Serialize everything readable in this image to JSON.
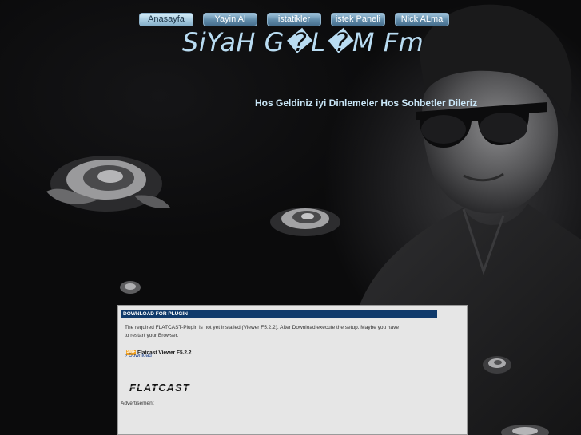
{
  "nav": {
    "items": [
      {
        "label": "Anasayfa",
        "active": true
      },
      {
        "label": "Yayin Al",
        "active": false
      },
      {
        "label": "istatikler",
        "active": false
      },
      {
        "label": "istek Paneli",
        "active": false
      },
      {
        "label": "Nick ALma",
        "active": false
      }
    ]
  },
  "site": {
    "title": "SiYaH G�L�M Fm",
    "welcome": "Hos Geldiniz iyi Dinlemeler Hos Sohbetler Dileriz"
  },
  "plugin_panel": {
    "header": "DOWNLOAD FOR PLUGIN",
    "message": "The required FLATCAST-Plugin is not yet installed (Viewer F5.2.2). After Download execute the setup. Maybe you have to restart your Browser.",
    "badge": "SWF",
    "plugin_name": "Flatcast Viewer F5.2.2",
    "download_chevron": "›",
    "download_label": "Download",
    "logo_text": "FLATCAST",
    "ad_label": "Advertisement"
  },
  "colors": {
    "nav_active": "#a7cbe0",
    "nav_inactive": "#5f8aa8",
    "title": "#b9dcf2",
    "panel_header": "#103a6b",
    "panel_bg": "#e6e6e6"
  }
}
